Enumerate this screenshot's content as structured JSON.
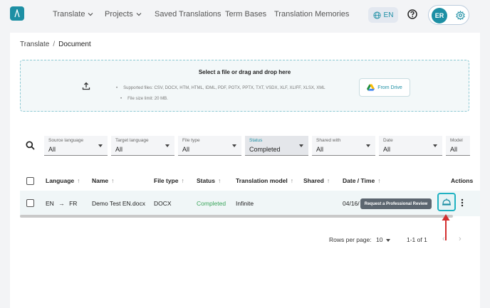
{
  "nav": {
    "items": [
      {
        "label": "Translate",
        "dropdown": true
      },
      {
        "label": "Projects",
        "dropdown": true
      },
      {
        "label": "Saved Translations",
        "dropdown": false
      },
      {
        "label": "Term Bases",
        "dropdown": false
      },
      {
        "label": "Translation Memories",
        "dropdown": false
      }
    ],
    "language": "EN",
    "user_initials": "ER"
  },
  "breadcrumb": {
    "root": "Translate",
    "separator": "/",
    "current": "Document"
  },
  "dropzone": {
    "title": "Select a file or drag and drop here",
    "supported": "Supported files: CSV, DOCX, HTM, HTML, IDML, PDF, POTX, PPTX, TXT, VSDX, XLF, XLIFF, XLSX, XML",
    "size_limit": "File size limit: 20 MB.",
    "drive_button": "From Drive"
  },
  "filters": [
    {
      "label": "Source language",
      "value": "All"
    },
    {
      "label": "Target language",
      "value": "All"
    },
    {
      "label": "File type",
      "value": "All"
    },
    {
      "label": "Status",
      "value": "Completed"
    },
    {
      "label": "Shared with",
      "value": "All"
    },
    {
      "label": "Date",
      "value": "All"
    },
    {
      "label": "Model",
      "value": "All"
    }
  ],
  "table": {
    "columns": [
      "Language",
      "Name",
      "File type",
      "Status",
      "Translation model",
      "Shared",
      "Date / Time",
      "Actions"
    ],
    "rows": [
      {
        "source_lang": "EN",
        "arrow": "→",
        "target_lang": "FR",
        "name": "Demo Test EN.docx",
        "file_type": "DOCX",
        "status": "Completed",
        "model": "Infinite",
        "shared": "",
        "date": "04/16/"
      }
    ],
    "tooltip": "Request a Professional Review"
  },
  "pagination": {
    "rows_label": "Rows per page:",
    "rows_value": "10",
    "range": "1-1 of 1"
  },
  "colors": {
    "accent": "#1d8fa4",
    "status_completed": "#3ba55c",
    "annotation_arrow": "#d32f2f"
  }
}
